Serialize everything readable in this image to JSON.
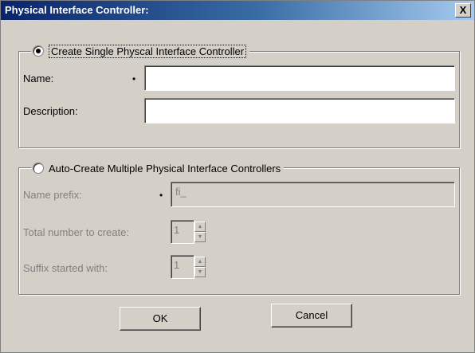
{
  "window": {
    "title": "Physical Interface Controller:",
    "close_glyph": "X"
  },
  "single": {
    "radio_label": "Create Single Physcal Interface Controller",
    "selected": true,
    "name_label": "Name:",
    "required_marker": "•",
    "name_value": "",
    "description_label": "Description:",
    "description_value": ""
  },
  "multiple": {
    "radio_label": "Auto-Create Multiple Physical Interface Controllers",
    "selected": false,
    "prefix_label": "Name prefix:",
    "required_marker": "•",
    "prefix_value": "fi_",
    "total_label": "Total number to create:",
    "total_value": "1",
    "suffix_label": "Suffix started with:",
    "suffix_value": "1"
  },
  "buttons": {
    "ok": "OK",
    "cancel": "Cancel"
  },
  "icons": {
    "spin_up": "▲",
    "spin_down": "▼"
  }
}
